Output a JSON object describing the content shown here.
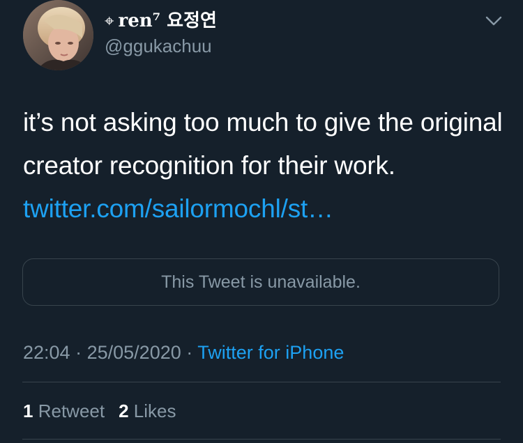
{
  "tweet": {
    "author": {
      "glyph": "⌖",
      "display_name": "ren⁷ 요정연",
      "handle": "@ggukachuu"
    },
    "text": "it’s not asking too much to give the original creator recognition for their work. ",
    "link_text": "twitter.com/sailormochl/st…",
    "quoted_tweet_text": "This Tweet is unavailable.",
    "time": "22:04",
    "date": "25/05/2020",
    "separator": "·",
    "source": "Twitter for iPhone",
    "retweets": {
      "count": "1",
      "label": "Retweet"
    },
    "likes": {
      "count": "2",
      "label": "Likes"
    }
  },
  "icons": {
    "avatar": "profile-photo",
    "menu": "chevron-down-icon"
  },
  "colors": {
    "background": "#15202b",
    "text": "#ffffff",
    "secondary_text": "#8899a6",
    "link": "#1da1f2",
    "border": "#38444d"
  }
}
